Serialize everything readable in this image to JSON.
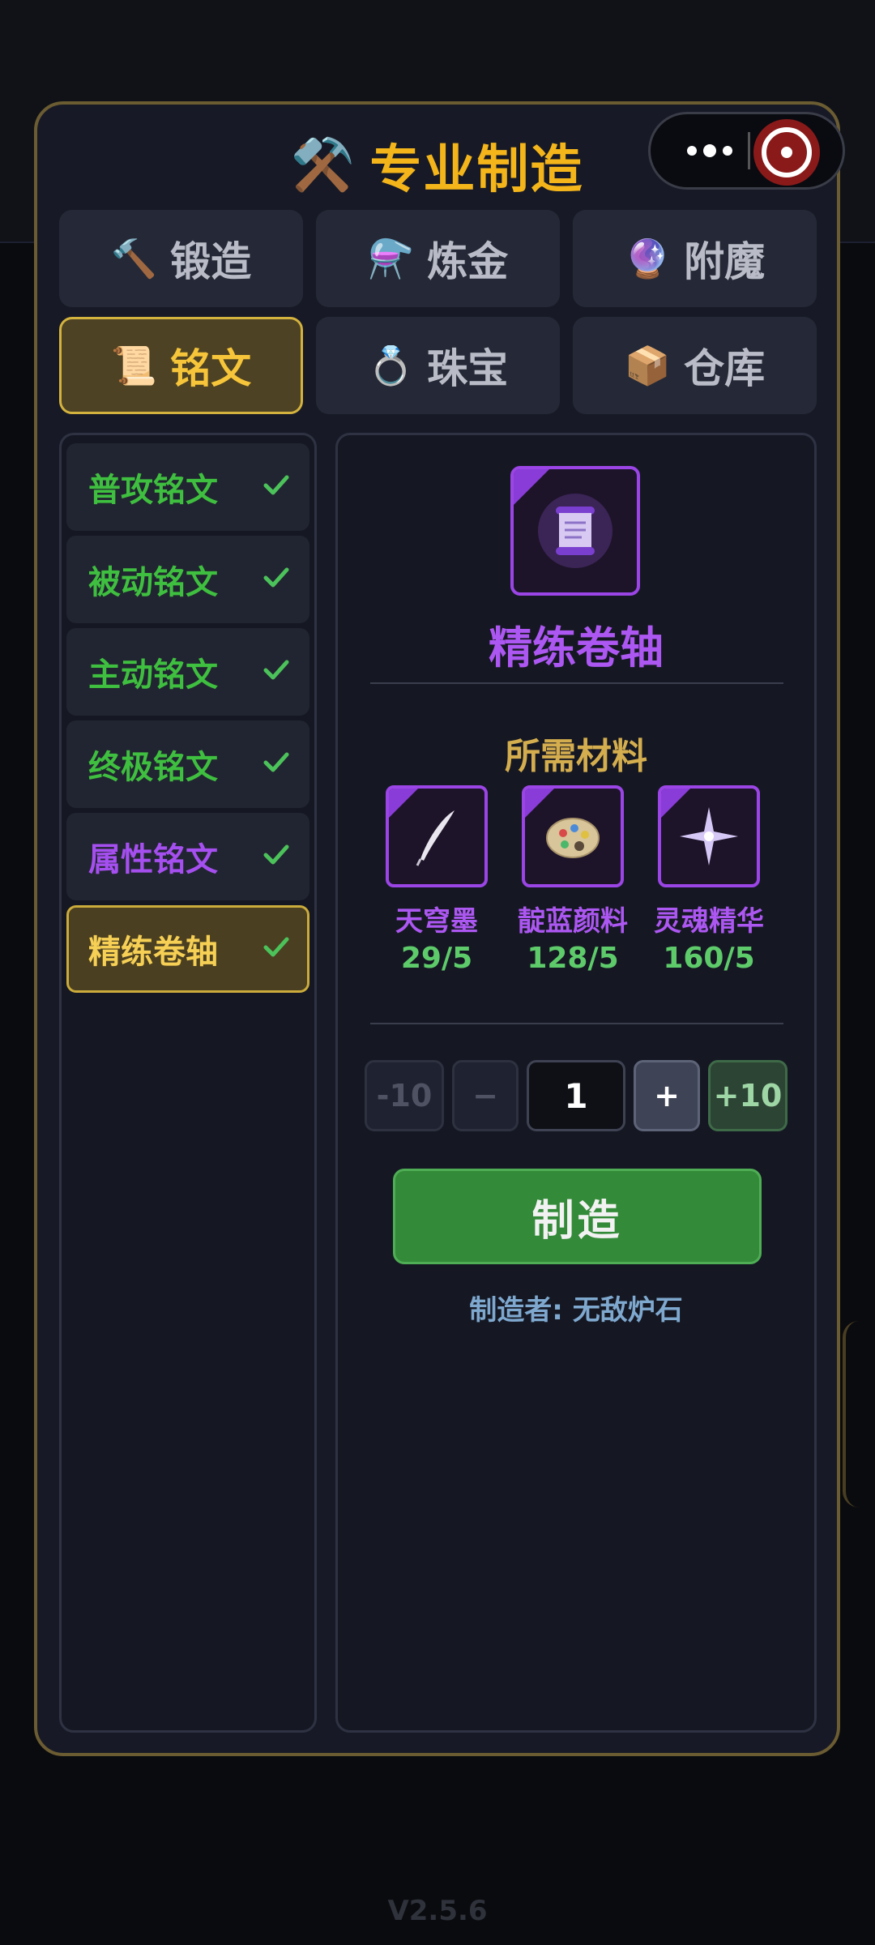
{
  "header": {
    "title": "专业制造",
    "title_icon": "⚒️"
  },
  "capsule": {
    "more_icon": "more-dots-icon",
    "close_icon": "close-target-icon"
  },
  "tabs": [
    {
      "label": "锻造",
      "icon": "🔨",
      "active": false
    },
    {
      "label": "炼金",
      "icon": "⚗️",
      "active": false
    },
    {
      "label": "附魔",
      "icon": "🔮",
      "active": false
    },
    {
      "label": "铭文",
      "icon": "📜",
      "active": true
    },
    {
      "label": "珠宝",
      "icon": "💍",
      "active": false
    },
    {
      "label": "仓库",
      "icon": "📦",
      "active": false
    }
  ],
  "recipes": [
    {
      "label": "普攻铭文",
      "color": "#3fbf3f",
      "checked": true
    },
    {
      "label": "被动铭文",
      "color": "#3fbf3f",
      "checked": true
    },
    {
      "label": "主动铭文",
      "color": "#3fbf3f",
      "checked": true
    },
    {
      "label": "终极铭文",
      "color": "#3fbf3f",
      "checked": true
    },
    {
      "label": "属性铭文",
      "color": "#a64ff0",
      "checked": true
    },
    {
      "label": "精练卷轴",
      "color": "#f6cf55",
      "checked": true,
      "selected": true
    }
  ],
  "detail": {
    "item_name": "精练卷轴",
    "item_icon": "scroll-icon",
    "materials_title": "所需材料",
    "materials": [
      {
        "name": "天穹墨",
        "count": "29/5",
        "icon": "quill-icon"
      },
      {
        "name": "靛蓝颜料",
        "count": "128/5",
        "icon": "palette-icon"
      },
      {
        "name": "灵魂精华",
        "count": "160/5",
        "icon": "sparkle-icon"
      }
    ],
    "quantity": {
      "minus10": "-10",
      "minus1": "−",
      "value": "1",
      "plus1": "+",
      "plus10": "+10"
    },
    "craft_label": "制造",
    "crafter": "制造者: 无敌炉石"
  },
  "footer": {
    "version": "V2.5.6"
  },
  "colors": {
    "accent_gold": "#f4b51b",
    "epic_purple": "#ad57f2",
    "craft_green": "#338a38"
  }
}
